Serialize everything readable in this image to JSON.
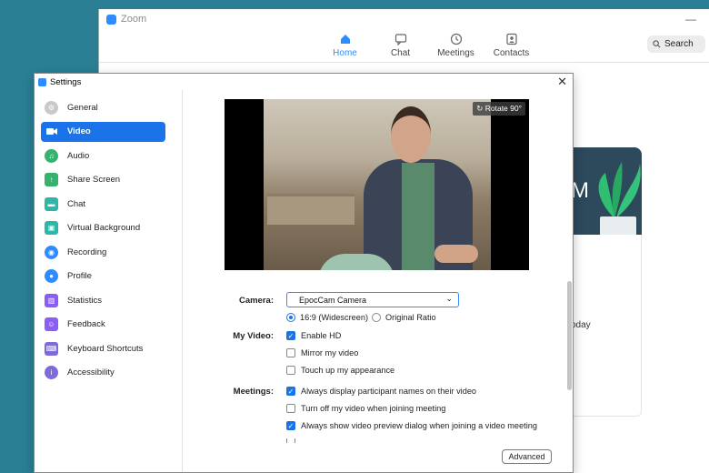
{
  "zoom_window": {
    "title": "Zoom",
    "nav": [
      {
        "label": "Home",
        "icon": "home-icon",
        "active": true
      },
      {
        "label": "Chat",
        "icon": "chat-icon",
        "active": false
      },
      {
        "label": "Meetings",
        "icon": "clock-icon",
        "active": false
      },
      {
        "label": "Contacts",
        "icon": "contacts-icon",
        "active": false
      }
    ],
    "search_label": "Search",
    "banner_letter": "M",
    "partial_text": "oday"
  },
  "settings": {
    "title": "Settings",
    "sidebar": [
      {
        "label": "General",
        "icon": "gear-icon",
        "color": "#c9c9c9"
      },
      {
        "label": "Video",
        "icon": "video-icon",
        "color": "#1a73e8",
        "active": true
      },
      {
        "label": "Audio",
        "icon": "headphones-icon",
        "color": "#35b26b"
      },
      {
        "label": "Share Screen",
        "icon": "share-screen-icon",
        "color": "#35b26b"
      },
      {
        "label": "Chat",
        "icon": "chat-icon",
        "color": "#2bb8a8"
      },
      {
        "label": "Virtual Background",
        "icon": "background-icon",
        "color": "#2bb8a8"
      },
      {
        "label": "Recording",
        "icon": "record-icon",
        "color": "#2d8cff"
      },
      {
        "label": "Profile",
        "icon": "profile-icon",
        "color": "#2d8cff"
      },
      {
        "label": "Statistics",
        "icon": "statistics-icon",
        "color": "#8b5cf6"
      },
      {
        "label": "Feedback",
        "icon": "feedback-icon",
        "color": "#8b5cf6"
      },
      {
        "label": "Keyboard Shortcuts",
        "icon": "keyboard-icon",
        "color": "#7c6cdb"
      },
      {
        "label": "Accessibility",
        "icon": "accessibility-icon",
        "color": "#7c6cdb"
      }
    ],
    "video": {
      "rotate_label": "Rotate 90°",
      "camera_label": "Camera:",
      "camera_value": "EpocCam Camera",
      "aspect_options": [
        {
          "label": "16:9 (Widescreen)",
          "selected": true
        },
        {
          "label": "Original Ratio",
          "selected": false
        }
      ],
      "my_video_label": "My Video:",
      "my_video_options": [
        {
          "label": "Enable HD",
          "checked": true
        },
        {
          "label": "Mirror my video",
          "checked": false
        },
        {
          "label": "Touch up my appearance",
          "checked": false
        }
      ],
      "meetings_label": "Meetings:",
      "meetings_options": [
        {
          "label": "Always display participant names on their video",
          "checked": true
        },
        {
          "label": "Turn off my video when joining meeting",
          "checked": false
        },
        {
          "label": "Always show video preview dialog when joining a video meeting",
          "checked": true
        }
      ],
      "advanced_label": "Advanced"
    }
  }
}
